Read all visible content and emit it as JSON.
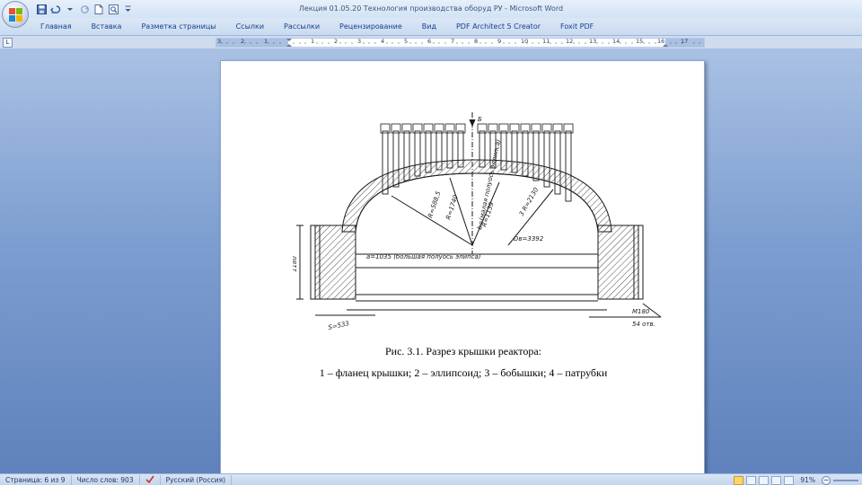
{
  "window": {
    "title": "Лекция 01.05.20 Технология производства оборуд РУ - Microsoft Word"
  },
  "qat": [
    "save-icon",
    "undo-icon",
    "redo-icon",
    "new-document-icon",
    "print-preview-icon",
    "customize-qat-icon"
  ],
  "tabs": [
    {
      "label": "Главная"
    },
    {
      "label": "Вставка"
    },
    {
      "label": "Разметка страницы"
    },
    {
      "label": "Ссылки"
    },
    {
      "label": "Рассылки"
    },
    {
      "label": "Рецензирование"
    },
    {
      "label": "Вид"
    },
    {
      "label": "PDF Architect 5 Creator"
    },
    {
      "label": "Foxit PDF"
    }
  ],
  "ruler": {
    "tab_selector": "L",
    "numbers": [
      "3",
      "2",
      "1",
      "1",
      "2",
      "3",
      "4",
      "5",
      "6",
      "7",
      "8",
      "9",
      "10",
      "11",
      "12",
      "13",
      "14",
      "15",
      "16",
      "17"
    ]
  },
  "figure": {
    "labels": {
      "arrow": "Б",
      "r1": "R=588,5",
      "r2": "R=1740",
      "r3": "R=1139",
      "r4": "3 R=2130",
      "dia": "Dв=3392",
      "axis_note": "a=1035 (большая полуось элипса)",
      "axis_note2": "b=(малая полуось эллипса)",
      "h": "1180",
      "bottom": "S=533",
      "bolt": "М180",
      "bolt2": "54 отв."
    }
  },
  "captions": {
    "title": "Рис. 3.1. Разрез крышки реактора:",
    "legend": "1 – фланец крышки; 2 – эллипсоид; 3 – бобышки; 4 – патрубки"
  },
  "status": {
    "page": "Страница: 6 из 9",
    "words": "Число слов: 903",
    "language": "Русский (Россия)",
    "zoom": "91%"
  }
}
